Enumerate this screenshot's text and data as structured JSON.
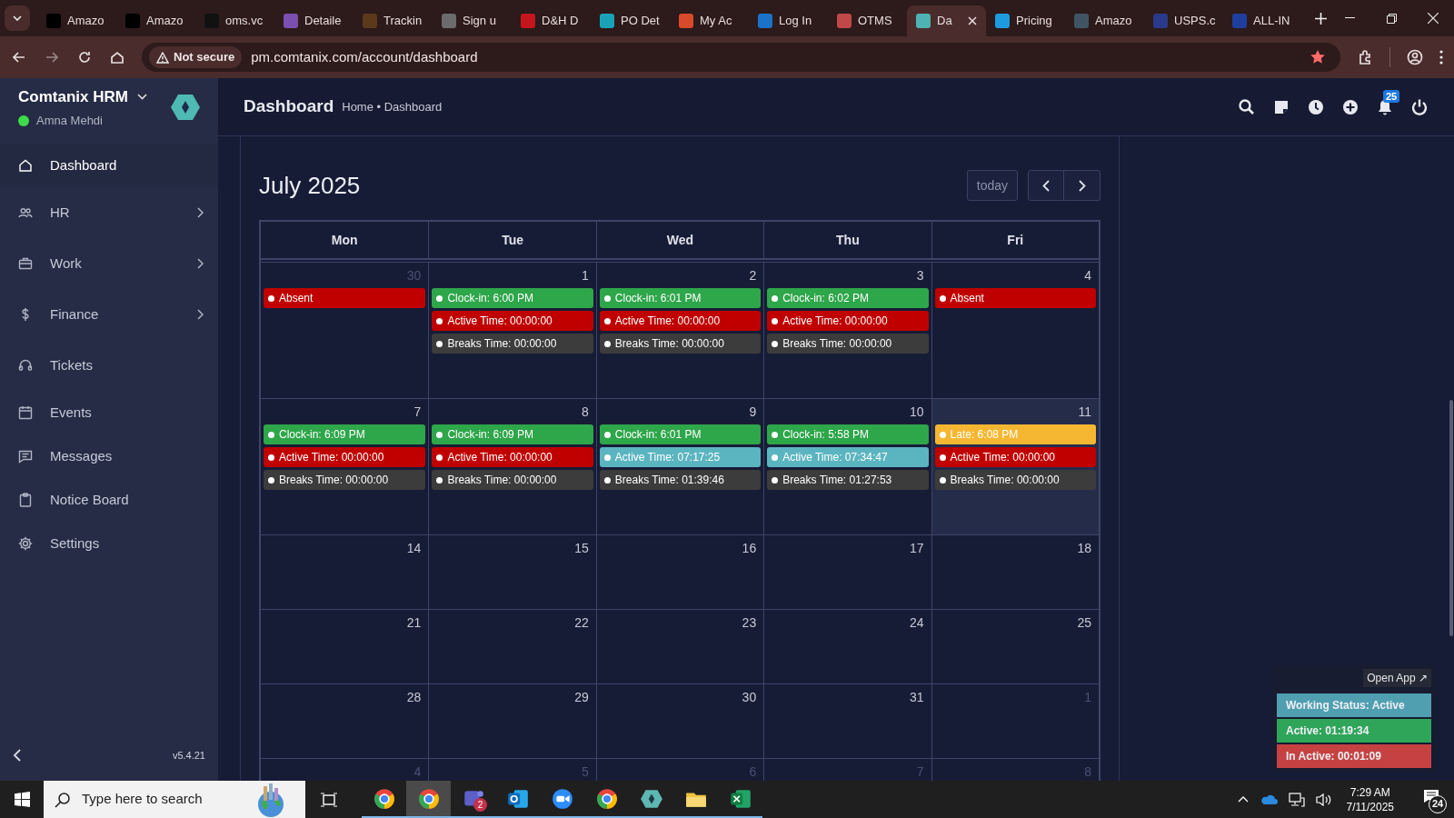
{
  "browser": {
    "tabs": [
      {
        "title": "Amazo",
        "selected": false,
        "color": "#000000"
      },
      {
        "title": "Amazo",
        "selected": false,
        "color": "#000000"
      },
      {
        "title": "oms.vc",
        "selected": false,
        "color": "#111111"
      },
      {
        "title": "Detaile",
        "selected": false,
        "color": "#7a4fb0"
      },
      {
        "title": "Trackin",
        "selected": false,
        "color": "#5a3a1a"
      },
      {
        "title": "Sign u",
        "selected": false,
        "color": "#6b6b6b"
      },
      {
        "title": "D&H D",
        "selected": false,
        "color": "#c4161c"
      },
      {
        "title": "PO Det",
        "selected": false,
        "color": "#1aa3b8"
      },
      {
        "title": "My Ac",
        "selected": false,
        "color": "#d84a2a"
      },
      {
        "title": "Log In",
        "selected": false,
        "color": "#1a73c8"
      },
      {
        "title": "OTMS",
        "selected": false,
        "color": "#c04848"
      },
      {
        "title": "Da",
        "selected": true,
        "color": "#4fb3b3"
      },
      {
        "title": "Pricing",
        "selected": false,
        "color": "#1e9be0"
      },
      {
        "title": "Amazo",
        "selected": false,
        "color": "#3f5564"
      },
      {
        "title": "USPS.c",
        "selected": false,
        "color": "#2a3a8a"
      },
      {
        "title": "ALL-IN",
        "selected": false,
        "color": "#1f3f9f"
      }
    ],
    "security": "Not secure",
    "url": "pm.comtanix.com/account/dashboard"
  },
  "sidebar": {
    "app_name": "Comtanix HRM",
    "user": "Amna Mehdi",
    "online": true,
    "items": [
      {
        "label": "Dashboard",
        "kind": "home",
        "selected": true,
        "has_submenu": false
      },
      {
        "label": "HR",
        "kind": "people",
        "selected": false,
        "has_submenu": true
      },
      {
        "label": "Work",
        "kind": "briefcase",
        "selected": false,
        "has_submenu": true
      },
      {
        "label": "Finance",
        "kind": "dollar",
        "selected": false,
        "has_submenu": true
      },
      {
        "label": "Tickets",
        "kind": "headset",
        "selected": false,
        "has_submenu": false
      },
      {
        "label": "Events",
        "kind": "calendar",
        "selected": false,
        "has_submenu": false
      },
      {
        "label": "Messages",
        "kind": "message",
        "selected": false,
        "has_submenu": false
      },
      {
        "label": "Notice Board",
        "kind": "clipboard",
        "selected": false,
        "has_submenu": false
      },
      {
        "label": "Settings",
        "kind": "gear",
        "selected": false,
        "has_submenu": false
      }
    ],
    "version": "v5.4.21"
  },
  "header": {
    "title": "Dashboard",
    "breadcrumb": "Home • Dashboard",
    "notification_count": "25"
  },
  "calendar": {
    "title": "July 2025",
    "today_button": "today",
    "weekdays": [
      "Mon",
      "Tue",
      "Wed",
      "Thu",
      "Fri"
    ],
    "weeks": [
      {
        "days": [
          {
            "number": "30",
            "other_month": true,
            "today": false,
            "events": [
              {
                "label": "Absent",
                "color": "#c00000"
              }
            ]
          },
          {
            "number": "1",
            "other_month": false,
            "today": false,
            "events": [
              {
                "label": "Clock-in: 6:00 PM",
                "color": "#2ea64a"
              },
              {
                "label": "Active Time: 00:00:00",
                "color": "#c00000"
              },
              {
                "label": "Breaks Time: 00:00:00",
                "color": "#3c3c3c"
              }
            ]
          },
          {
            "number": "2",
            "other_month": false,
            "today": false,
            "events": [
              {
                "label": "Clock-in: 6:01 PM",
                "color": "#2ea64a"
              },
              {
                "label": "Active Time: 00:00:00",
                "color": "#c00000"
              },
              {
                "label": "Breaks Time: 00:00:00",
                "color": "#3c3c3c"
              }
            ]
          },
          {
            "number": "3",
            "other_month": false,
            "today": false,
            "events": [
              {
                "label": "Clock-in: 6:02 PM",
                "color": "#2ea64a"
              },
              {
                "label": "Active Time: 00:00:00",
                "color": "#c00000"
              },
              {
                "label": "Breaks Time: 00:00:00",
                "color": "#3c3c3c"
              }
            ]
          },
          {
            "number": "4",
            "other_month": false,
            "today": false,
            "events": [
              {
                "label": "Absent",
                "color": "#c00000"
              }
            ]
          }
        ]
      },
      {
        "days": [
          {
            "number": "7",
            "other_month": false,
            "today": false,
            "events": [
              {
                "label": "Clock-in: 6:09 PM",
                "color": "#2ea64a"
              },
              {
                "label": "Active Time: 00:00:00",
                "color": "#c00000"
              },
              {
                "label": "Breaks Time: 00:00:00",
                "color": "#3c3c3c"
              }
            ]
          },
          {
            "number": "8",
            "other_month": false,
            "today": false,
            "events": [
              {
                "label": "Clock-in: 6:09 PM",
                "color": "#2ea64a"
              },
              {
                "label": "Active Time: 00:00:00",
                "color": "#c00000"
              },
              {
                "label": "Breaks Time: 00:00:00",
                "color": "#3c3c3c"
              }
            ]
          },
          {
            "number": "9",
            "other_month": false,
            "today": false,
            "events": [
              {
                "label": "Clock-in: 6:01 PM",
                "color": "#2ea64a"
              },
              {
                "label": "Active Time: 07:17:25",
                "color": "#5bb5c0"
              },
              {
                "label": "Breaks Time: 01:39:46",
                "color": "#3c3c3c"
              }
            ]
          },
          {
            "number": "10",
            "other_month": false,
            "today": false,
            "events": [
              {
                "label": "Clock-in: 5:58 PM",
                "color": "#2ea64a"
              },
              {
                "label": "Active Time: 07:34:47",
                "color": "#5bb5c0"
              },
              {
                "label": "Breaks Time: 01:27:53",
                "color": "#3c3c3c"
              }
            ]
          },
          {
            "number": "11",
            "other_month": false,
            "today": true,
            "events": [
              {
                "label": "Late: 6:08 PM",
                "color": "#f5b731"
              },
              {
                "label": "Active Time: 00:00:00",
                "color": "#c00000"
              },
              {
                "label": "Breaks Time: 00:00:00",
                "color": "#3c3c3c"
              }
            ]
          }
        ]
      },
      {
        "days": [
          {
            "number": "14",
            "other_month": false,
            "today": false
          },
          {
            "number": "15",
            "other_month": false,
            "today": false
          },
          {
            "number": "16",
            "other_month": false,
            "today": false
          },
          {
            "number": "17",
            "other_month": false,
            "today": false
          },
          {
            "number": "18",
            "other_month": false,
            "today": false
          }
        ]
      },
      {
        "days": [
          {
            "number": "21",
            "other_month": false,
            "today": false
          },
          {
            "number": "22",
            "other_month": false,
            "today": false
          },
          {
            "number": "23",
            "other_month": false,
            "today": false
          },
          {
            "number": "24",
            "other_month": false,
            "today": false
          },
          {
            "number": "25",
            "other_month": false,
            "today": false
          }
        ]
      },
      {
        "days": [
          {
            "number": "28",
            "other_month": false,
            "today": false
          },
          {
            "number": "29",
            "other_month": false,
            "today": false
          },
          {
            "number": "30",
            "other_month": false,
            "today": false
          },
          {
            "number": "31",
            "other_month": false,
            "today": false
          },
          {
            "number": "1",
            "other_month": true,
            "today": false
          }
        ]
      },
      {
        "days": [
          {
            "number": "4",
            "other_month": true,
            "today": false
          },
          {
            "number": "5",
            "other_month": true,
            "today": false
          },
          {
            "number": "6",
            "other_month": true,
            "today": false
          },
          {
            "number": "7",
            "other_month": true,
            "today": false
          },
          {
            "number": "8",
            "other_month": true,
            "today": false
          }
        ]
      }
    ]
  },
  "work_widget": {
    "open_app": "Open App ↗",
    "statuses": [
      {
        "label": "Working Status: Active",
        "color": "#4f9fb1"
      },
      {
        "label": "Active: 01:19:34",
        "color": "#2fa55a"
      },
      {
        "label": "In Active: 00:01:09",
        "color": "#c64242"
      }
    ]
  },
  "taskbar": {
    "search_placeholder": "Type here to search",
    "apps": [
      {
        "kind": "chrome",
        "selected": false
      },
      {
        "kind": "chrome",
        "selected": true
      },
      {
        "kind": "teams",
        "selected": false,
        "badge": "2"
      },
      {
        "kind": "outlook",
        "selected": false
      },
      {
        "kind": "zoom",
        "selected": false
      },
      {
        "kind": "chrome",
        "selected": false
      },
      {
        "kind": "hexagon",
        "selected": false
      },
      {
        "kind": "folder",
        "selected": false
      },
      {
        "kind": "excel",
        "selected": false
      }
    ],
    "time": "7:29 AM",
    "date": "7/11/2025",
    "notifications": "24"
  }
}
